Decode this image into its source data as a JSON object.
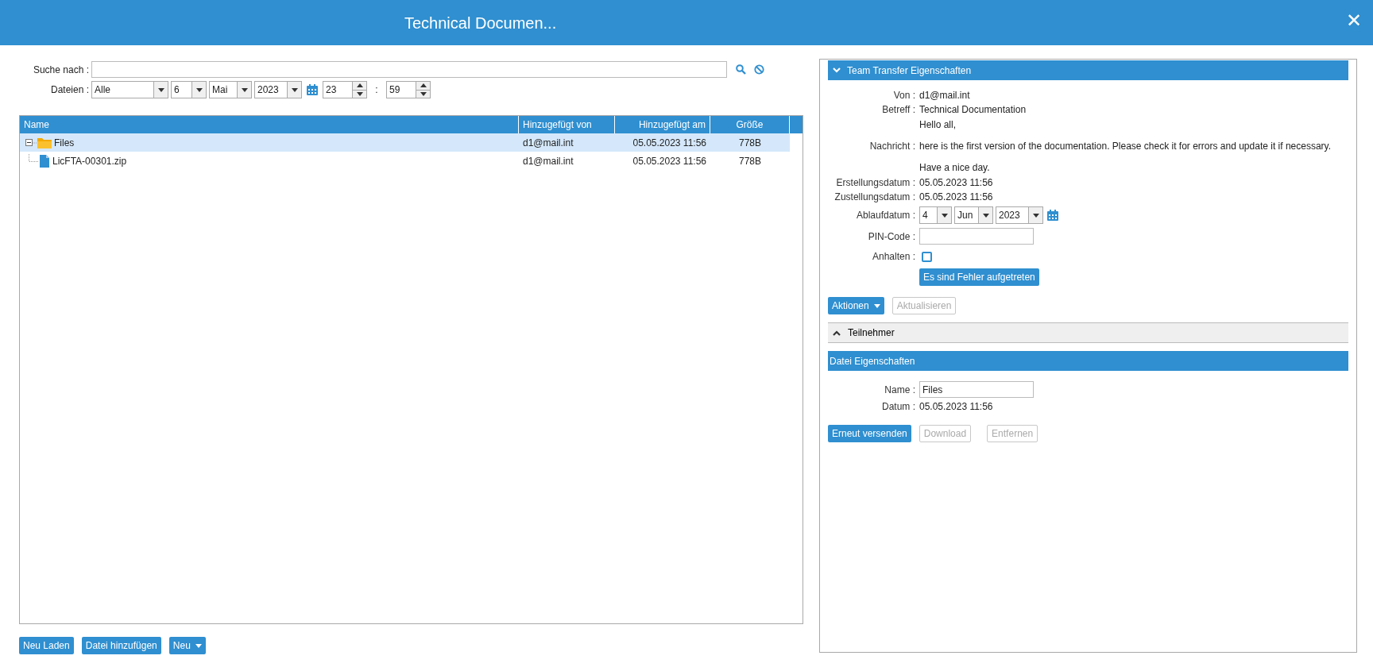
{
  "window": {
    "title": "Technical Documen...",
    "close": "✕"
  },
  "search": {
    "label": "Suche nach :"
  },
  "files_filter": {
    "label": "Dateien :",
    "type": "Alle",
    "day": "6",
    "month": "Mai",
    "year": "2023",
    "hour": "23",
    "separator": ":",
    "minute": "59"
  },
  "tree": {
    "columns": [
      "Name",
      "Hinzugefügt von",
      "Hinzugefügt am",
      "Größe"
    ],
    "rows": [
      {
        "name": "Files",
        "kind": "folder",
        "expanded": true,
        "selected": true,
        "added_by": "d1@mail.int",
        "added_at": "05.05.2023 11:56",
        "size": "778B",
        "children": [
          {
            "name": "LicFTA-00301.zip",
            "kind": "file",
            "selected": false,
            "added_by": "d1@mail.int",
            "added_at": "05.05.2023 11:56",
            "size": "778B"
          }
        ]
      }
    ]
  },
  "left_buttons": [
    {
      "label": "Neu Laden",
      "kind": "button"
    },
    {
      "label": "Datei hinzufügen",
      "kind": "button"
    },
    {
      "label": "Neu",
      "kind": "dropdown"
    }
  ],
  "team_transfer": {
    "title": "Team Transfer Eigenschaften",
    "expanded": true,
    "fields": [
      {
        "label": "Von :",
        "kind": "text",
        "value": "d1@mail.int"
      },
      {
        "label": "Betreff :",
        "kind": "text",
        "value": "Technical Documentation"
      },
      {
        "label": "Nachricht :",
        "kind": "message",
        "lines": [
          "Hello all,",
          "here is the first version of the documentation. Please check it for errors and update it if necessary.",
          "Have a nice day."
        ]
      },
      {
        "label": "Erstellungsdatum :",
        "kind": "text",
        "value": "05.05.2023 11:56"
      },
      {
        "label": "Zustellungsdatum :",
        "kind": "text",
        "value": "05.05.2023 11:56"
      },
      {
        "label": "Ablaufdatum :",
        "kind": "date",
        "day": "4",
        "month": "Jun",
        "year": "2023"
      },
      {
        "label": "PIN-Code :",
        "kind": "input"
      },
      {
        "label": "Anhalten :",
        "kind": "checkbox",
        "checked": false
      }
    ],
    "error_button": "Es sind Fehler aufgetreten",
    "actions": [
      {
        "label": "Aktionen",
        "kind": "dropdown",
        "disabled": false
      },
      {
        "label": "Aktualisieren",
        "kind": "button",
        "disabled": true
      }
    ]
  },
  "participants": {
    "title": "Teilnehmer",
    "expanded": false
  },
  "file_properties": {
    "title": "Datei Eigenschaften",
    "fields": [
      {
        "label": "Name :",
        "kind": "input",
        "value": "Files"
      },
      {
        "label": "Datum :",
        "kind": "text",
        "value": "05.05.2023 11:56"
      }
    ],
    "buttons": [
      {
        "label": "Erneut versenden",
        "disabled": false
      },
      {
        "label": "Download",
        "disabled": true
      },
      {
        "label": "Entfernen",
        "disabled": true
      }
    ]
  }
}
